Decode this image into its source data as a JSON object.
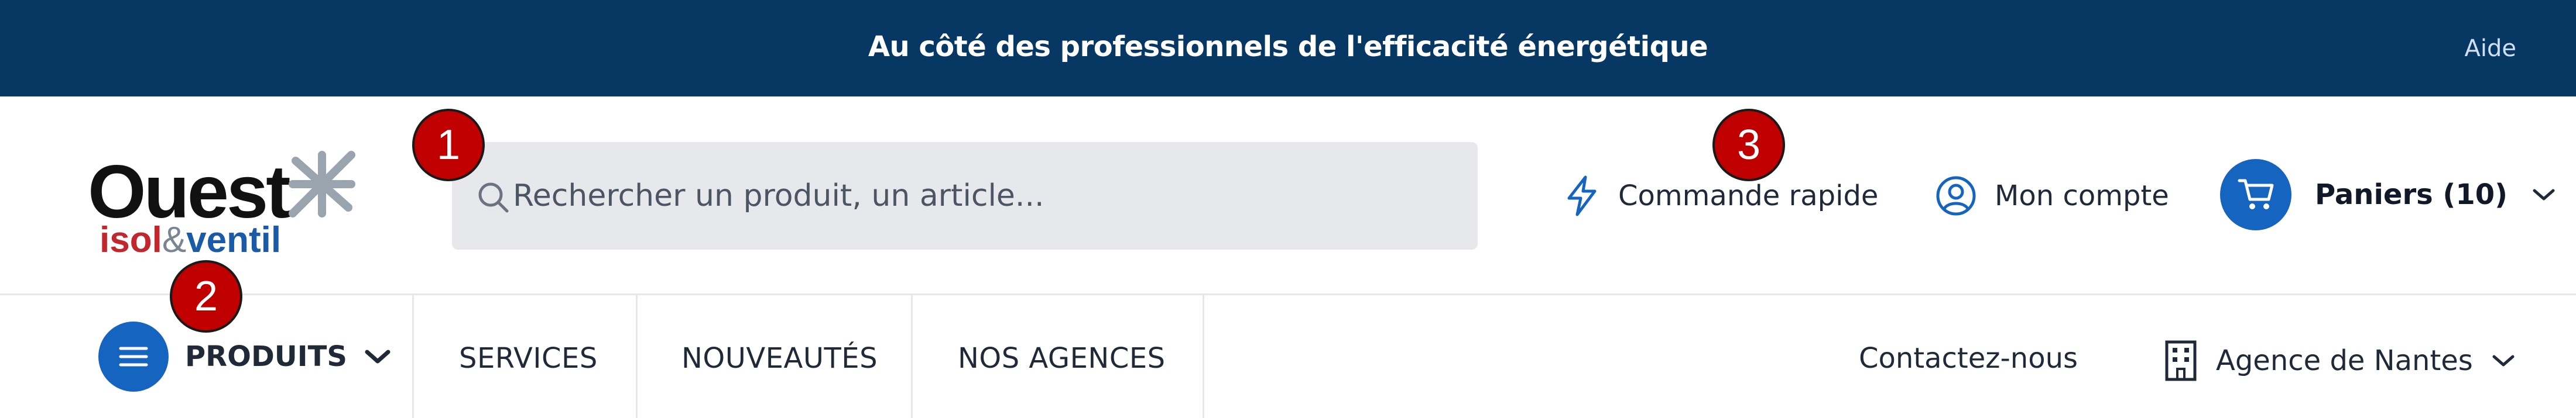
{
  "banner": {
    "tagline": "Au côté des professionnels de l'efficacité énergétique",
    "help_label": "Aide",
    "background": "#073763"
  },
  "logo": {
    "word_main": "Ouest",
    "word_isol": "isol",
    "word_amp": "&",
    "word_ventil": "ventil"
  },
  "search": {
    "placeholder": "Rechercher un produit, un article..."
  },
  "header": {
    "quick_order_label": "Commande rapide",
    "account_label": "Mon compte",
    "cart_label": "Paniers (10)",
    "accent": "#1565c0"
  },
  "nav": {
    "products_label": "PRODUITS",
    "links": [
      "SERVICES",
      "NOUVEAUTÉS",
      "NOS AGENCES"
    ],
    "contact_label": "Contactez-nous",
    "agency_label": "Agence de Nantes"
  },
  "markers": [
    "1",
    "2",
    "3"
  ],
  "icons": {
    "search": "search-icon",
    "quick_order": "lightning-icon",
    "account": "user-circle-icon",
    "cart": "cart-icon",
    "menu": "hamburger-icon",
    "agency": "building-icon",
    "chevron": "chevron-down-icon"
  }
}
